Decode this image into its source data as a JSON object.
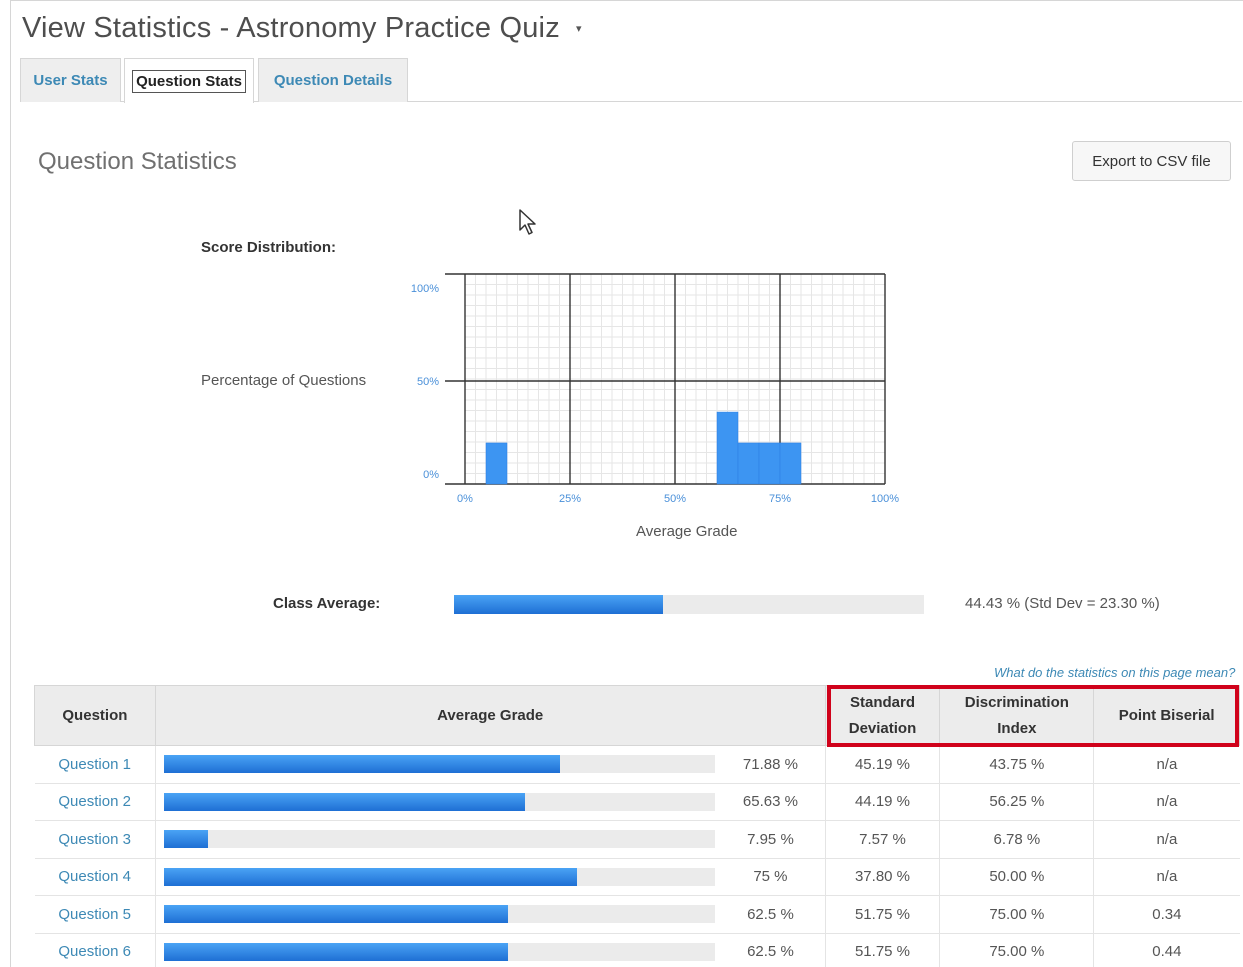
{
  "page": {
    "title": "View Statistics - Astronomy Practice Quiz",
    "caret": "▾"
  },
  "tabs": [
    {
      "label": "User Stats"
    },
    {
      "label": "Question Stats"
    },
    {
      "label": "Question Details"
    }
  ],
  "section_title": "Question Statistics",
  "export_label": "Export to CSV file",
  "score_distribution_label": "Score Distribution:",
  "class_average": {
    "label": "Class Average:",
    "value": 44.43,
    "text": "44.43 %  (Std Dev = 23.30 %)"
  },
  "help_link": "What do the statistics on this page mean?",
  "chart_data": {
    "type": "bar",
    "xlabel": "Average Grade",
    "ylabel": "Percentage of Questions",
    "x_ticks": [
      "0%",
      "25%",
      "50%",
      "75%",
      "100%"
    ],
    "y_ticks": [
      "100%",
      "50%",
      "0%"
    ],
    "xlim": [
      0,
      100
    ],
    "ylim": [
      0,
      100
    ],
    "bins": [
      {
        "from": 5,
        "to": 10,
        "value": 16.7
      },
      {
        "from": 60,
        "to": 65,
        "value": 33.3
      },
      {
        "from": 65,
        "to": 70,
        "value": 16.7
      },
      {
        "from": 70,
        "to": 75,
        "value": 16.7
      },
      {
        "from": 75,
        "to": 80,
        "value": 16.7
      }
    ]
  },
  "table": {
    "headers": {
      "question": "Question",
      "average_grade": "Average Grade",
      "std_dev_1": "Standard",
      "std_dev_2": "Deviation",
      "disc_1": "Discrimination",
      "disc_2": "Index",
      "point_biserial": "Point Biserial"
    },
    "rows": [
      {
        "question": "Question 1",
        "avg": 71.88,
        "avg_text": "71.88 %",
        "std": "45.19 %",
        "disc": "43.75 %",
        "pb": "n/a"
      },
      {
        "question": "Question 2",
        "avg": 65.63,
        "avg_text": "65.63 %",
        "std": "44.19 %",
        "disc": "56.25 %",
        "pb": "n/a"
      },
      {
        "question": "Question 3",
        "avg": 7.95,
        "avg_text": "7.95 %",
        "std": "7.57 %",
        "disc": "6.78 %",
        "pb": "n/a"
      },
      {
        "question": "Question 4",
        "avg": 75,
        "avg_text": "75 %",
        "std": "37.80 %",
        "disc": "50.00 %",
        "pb": "n/a"
      },
      {
        "question": "Question 5",
        "avg": 62.5,
        "avg_text": "62.5 %",
        "std": "51.75 %",
        "disc": "75.00 %",
        "pb": "0.34"
      },
      {
        "question": "Question 6",
        "avg": 62.5,
        "avg_text": "62.5 %",
        "std": "51.75 %",
        "disc": "75.00 %",
        "pb": "0.44"
      }
    ]
  },
  "colors": {
    "accent_link": "#3d89b5",
    "bar_fill": "#2a7de1",
    "highlight": "#d0021b"
  }
}
